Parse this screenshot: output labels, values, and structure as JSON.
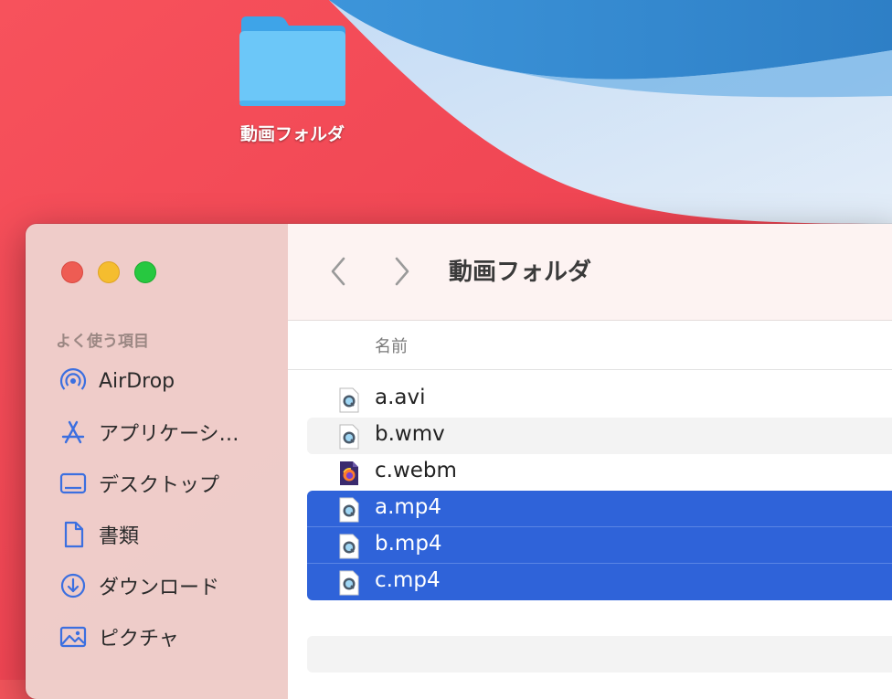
{
  "desktop": {
    "folder_label": "動画フォルダ"
  },
  "window": {
    "title": "動画フォルダ"
  },
  "sidebar": {
    "section_title": "よく使う項目",
    "items": [
      {
        "label": "AirDrop",
        "icon": "airdrop-icon"
      },
      {
        "label": "アプリケーシ…",
        "icon": "applications-icon"
      },
      {
        "label": "デスクトップ",
        "icon": "desktop-icon"
      },
      {
        "label": "書類",
        "icon": "document-icon"
      },
      {
        "label": "ダウンロード",
        "icon": "download-icon"
      },
      {
        "label": "ピクチャ",
        "icon": "pictures-icon"
      }
    ]
  },
  "list": {
    "column_name": "名前",
    "files": [
      {
        "name": "a.avi",
        "icon": "quicktime-file-icon",
        "selected": false
      },
      {
        "name": "b.wmv",
        "icon": "quicktime-file-icon",
        "selected": false
      },
      {
        "name": "c.webm",
        "icon": "firefox-file-icon",
        "selected": false
      },
      {
        "name": "a.mp4",
        "icon": "quicktime-file-icon",
        "selected": true
      },
      {
        "name": "b.mp4",
        "icon": "quicktime-file-icon",
        "selected": true
      },
      {
        "name": "c.mp4",
        "icon": "quicktime-file-icon",
        "selected": true
      }
    ]
  },
  "colors": {
    "selection": "#2f63d9",
    "sidebar_icon": "#3b6fe0",
    "folder": "#5bbcf4"
  }
}
